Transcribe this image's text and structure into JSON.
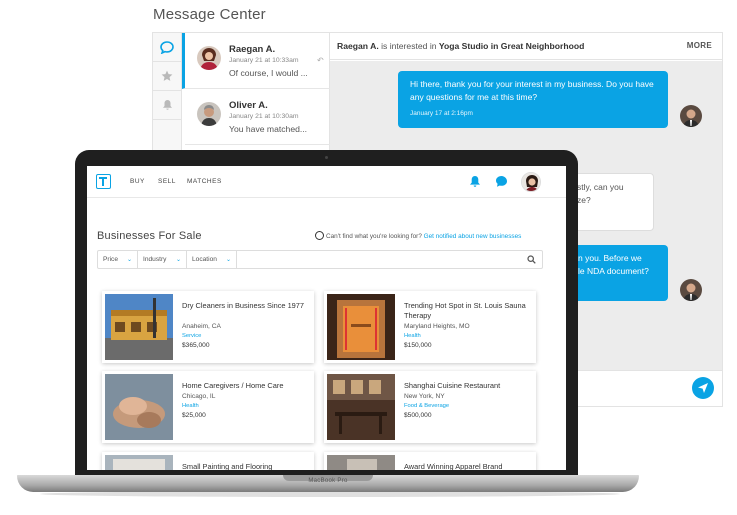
{
  "message_center": {
    "title": "Message Center",
    "conversations": [
      {
        "name": "Raegan A.",
        "time": "January 21 at 10:33am",
        "preview": "Of course, I would ..."
      },
      {
        "name": "Oliver A.",
        "time": "January 21 at 10:30am",
        "preview": "You have matched..."
      }
    ],
    "header": {
      "name": "Raegan A.",
      "middle": " is interested in ",
      "listing": "Yoga Studio in Great Neighborhood",
      "more": "MORE"
    },
    "messages": [
      {
        "text": "Hi there, thank you for your interest in my business. Do you have any questions for me at this time?",
        "time": "January 17 at 2:16pm"
      },
      {
        "text": "stly, can you\nze?"
      },
      {
        "text": "n you. Before we\nle NDA document?"
      }
    ]
  },
  "app": {
    "nav": {
      "buy": "BUY",
      "sell": "SELL",
      "matches": "MATCHES"
    },
    "page_title": "Businesses For Sale",
    "notify": {
      "text": "Can't find what you're looking for? ",
      "link": "Get notified about new businesses"
    },
    "filters": {
      "price": "Price",
      "industry": "Industry",
      "location": "Location"
    },
    "listings": [
      {
        "title": "Dry Cleaners in Business Since 1977",
        "location": "Anaheim, CA",
        "category": "Service",
        "price": "$365,000"
      },
      {
        "title": "Trending Hot Spot in St. Louis Sauna Therapy",
        "location": "Maryland Heights, MO",
        "category": "Health",
        "price": "$150,000"
      },
      {
        "title": "Home Caregivers / Home Care",
        "location": "Chicago, IL",
        "category": "Health",
        "price": "$25,000"
      },
      {
        "title": "Shanghai Cuisine Restaurant",
        "location": "New York, NY",
        "category": "Food & Beverage",
        "price": "$500,000"
      },
      {
        "title": "Small Painting and Flooring"
      },
      {
        "title": "Award Winning Apparel Brand"
      }
    ]
  },
  "device_label": "MacBook Pro",
  "colors": {
    "accent": "#0aa3e4",
    "lid": "#1f1f1f",
    "thread_bg": "#ececec"
  }
}
